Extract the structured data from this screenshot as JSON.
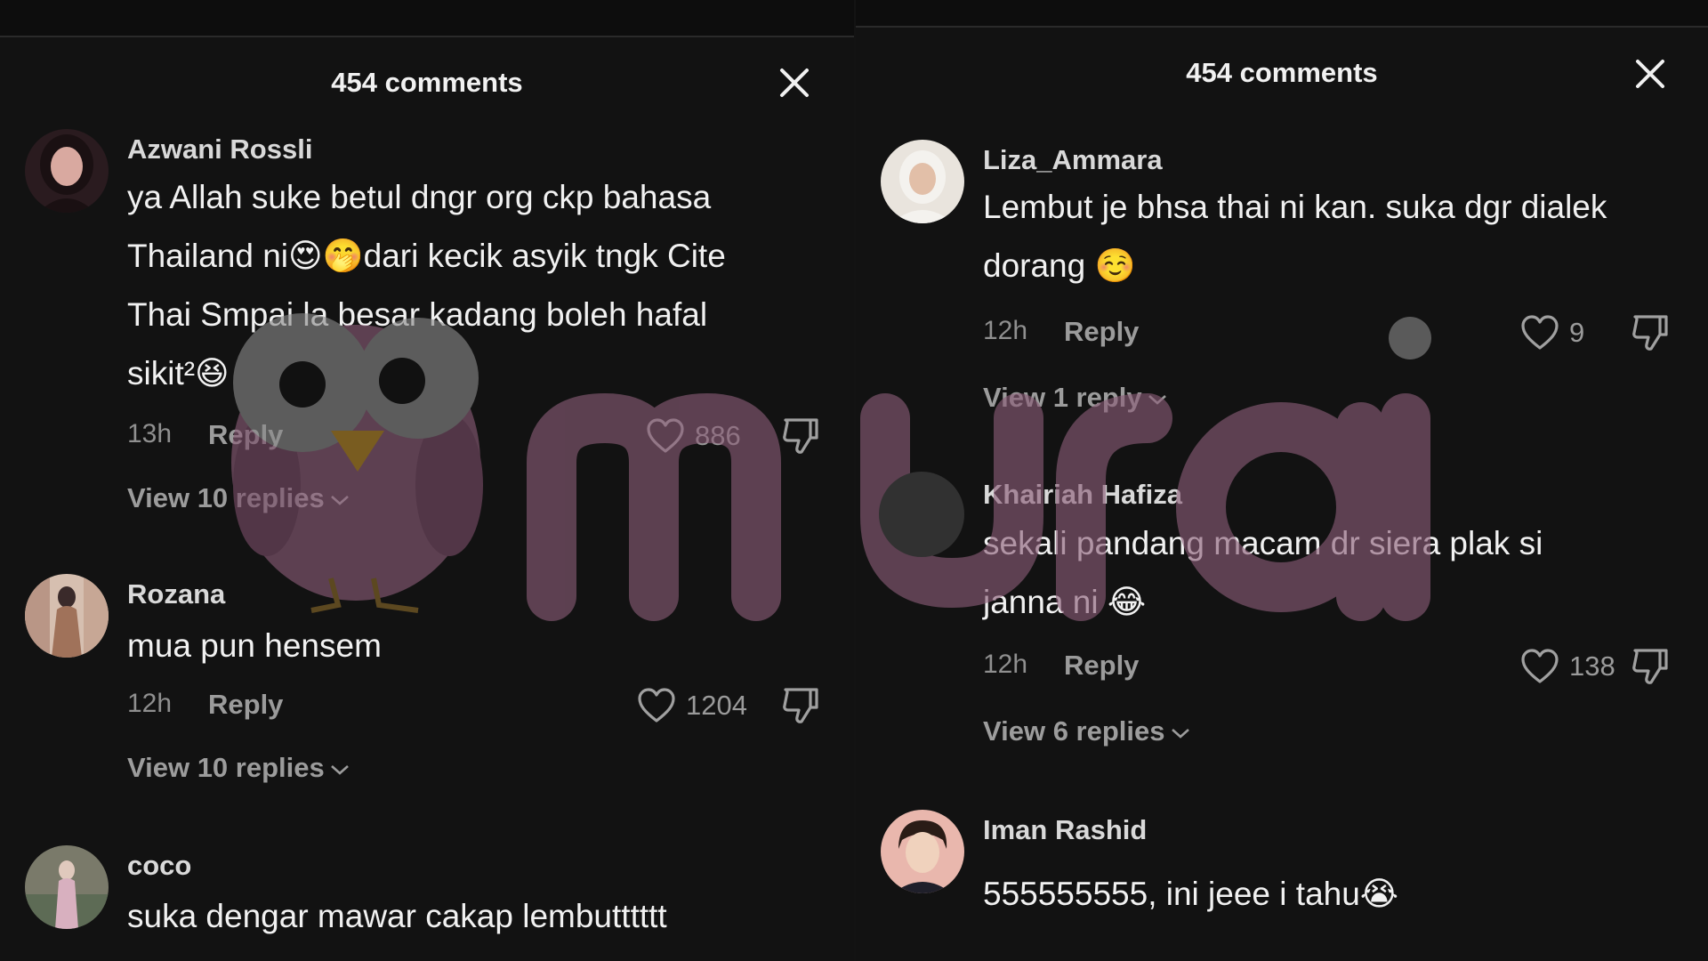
{
  "panels": [
    {
      "header": "454 comments",
      "comments": [
        {
          "author": "Azwani Rossli",
          "lines": [
            "ya Allah suke betul dngr org ckp bahasa",
            "Thailand ni😍🤭dari kecik asyik tngk Cite",
            "Thai Smpai la besar kadang boleh hafal",
            "sikit²😆"
          ],
          "time": "13h",
          "reply": "Reply",
          "likes": "886",
          "view_replies": "View 10 replies"
        },
        {
          "author": "Rozana",
          "lines": [
            "mua pun hensem"
          ],
          "time": "12h",
          "reply": "Reply",
          "likes": "1204",
          "view_replies": "View 10 replies"
        },
        {
          "author": "coco",
          "lines": [
            "suka dengar mawar cakap lembutttttt"
          ]
        }
      ]
    },
    {
      "header": "454 comments",
      "comments": [
        {
          "author": "Liza_Ammara",
          "lines": [
            "Lembut je bhsa thai ni kan. suka dgr dialek",
            "dorang ☺️"
          ],
          "time": "12h",
          "reply": "Reply",
          "likes": "9",
          "view_replies": "View 1 reply"
        },
        {
          "author": "Khairiah Hafiza",
          "lines": [
            "sekali pandang macam dr siera plak si",
            "janna ni 😂"
          ],
          "time": "12h",
          "reply": "Reply",
          "likes": "138",
          "view_replies": "View 6 replies"
        },
        {
          "author": "Iman Rashid",
          "lines": [
            "555555555, ini jeee i tahu😭"
          ]
        }
      ]
    }
  ],
  "watermark": {
    "text": "murai",
    "color": "#8b5d78"
  },
  "icons": {
    "close": "close-icon",
    "like": "heart-outline-icon",
    "dislike": "thumbs-down-icon",
    "expand": "chevron-down-icon"
  }
}
